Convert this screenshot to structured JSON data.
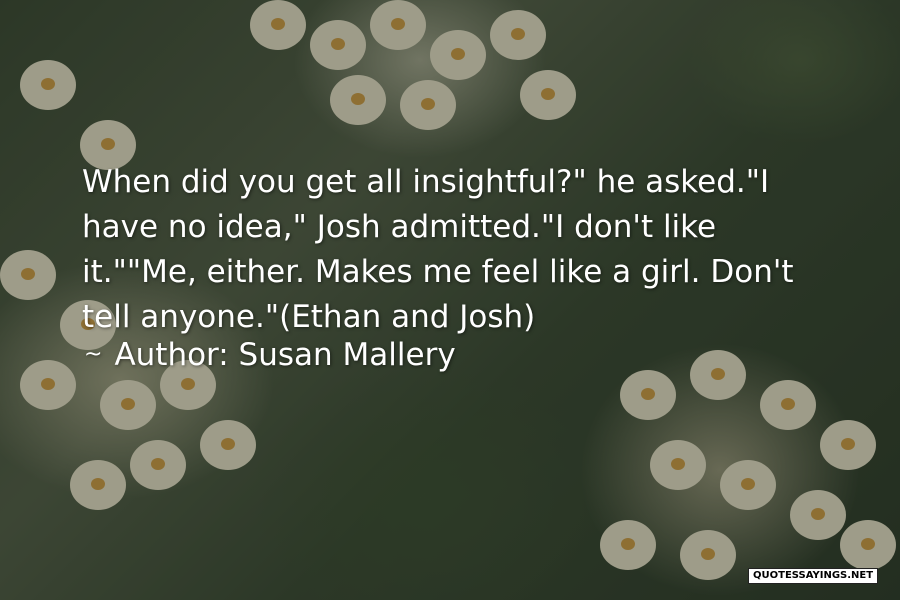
{
  "quote": {
    "text": "When did you get all insightful?\" he asked.\"I have no idea,\" Josh admitted.\"I don't like it.\"\"Me, either. Makes me feel like a girl. Don't tell anyone.\"(Ethan and Josh)",
    "author_prefix": "~",
    "author_label": "Author: Susan Mallery"
  },
  "watermark": {
    "text": "QUOTESSAYINGS.NET"
  },
  "colors": {
    "text": "#ffffff",
    "petal": "#f2ecd2",
    "petal_center": "#d9a447",
    "foliage": "#3b4a34"
  }
}
